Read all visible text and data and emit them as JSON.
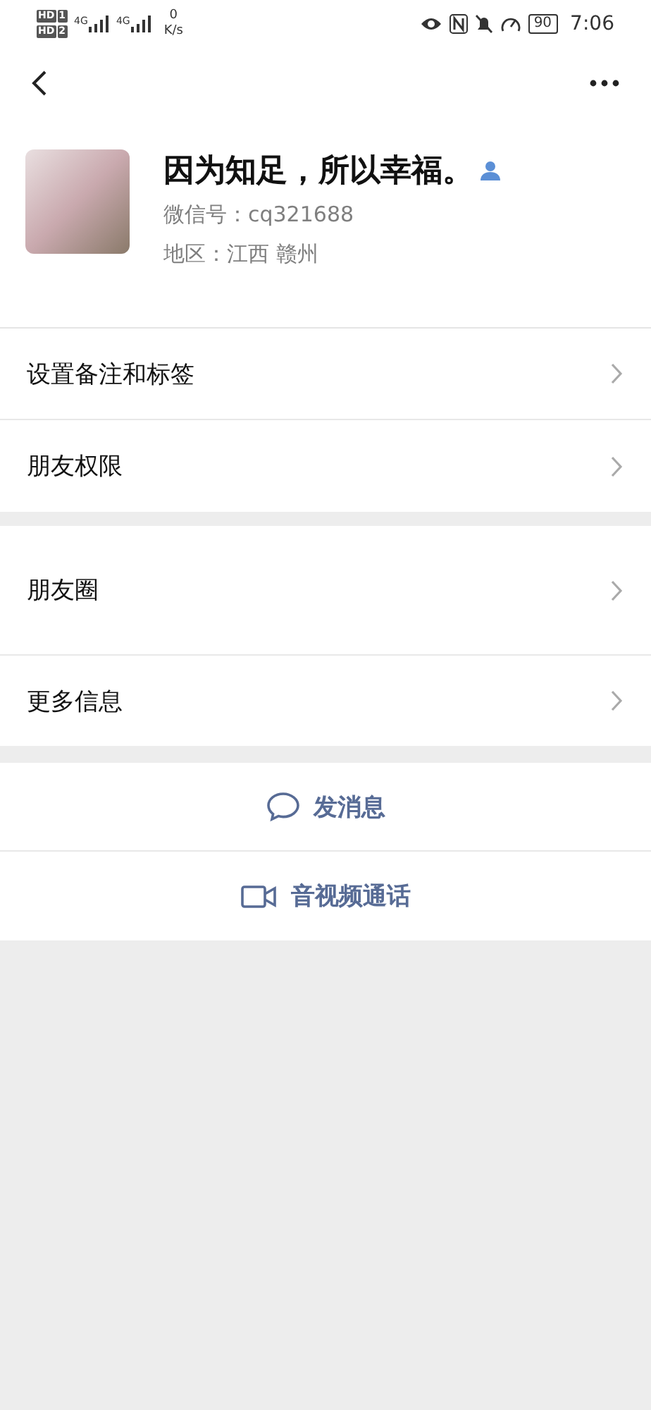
{
  "status_bar": {
    "sims": [
      {
        "badge": "HD",
        "slot": "1",
        "network": "4G"
      },
      {
        "badge": "HD",
        "slot": "2",
        "network": "4G"
      }
    ],
    "speed_value": "0",
    "speed_unit": "K/s",
    "battery": "90",
    "time": "7:06"
  },
  "profile": {
    "name": "因为知足，所以幸福。",
    "wechat_id": "微信号：cq321688",
    "region": "地区：江西  赣州"
  },
  "sections": [
    {
      "rows": [
        {
          "label": "设置备注和标签"
        },
        {
          "label": "朋友权限"
        }
      ]
    },
    {
      "rows": [
        {
          "label": "朋友圈"
        },
        {
          "label": "更多信息"
        }
      ]
    }
  ],
  "actions": [
    {
      "kind": "message",
      "label": "发消息"
    },
    {
      "kind": "video",
      "label": "音视频通话"
    }
  ]
}
